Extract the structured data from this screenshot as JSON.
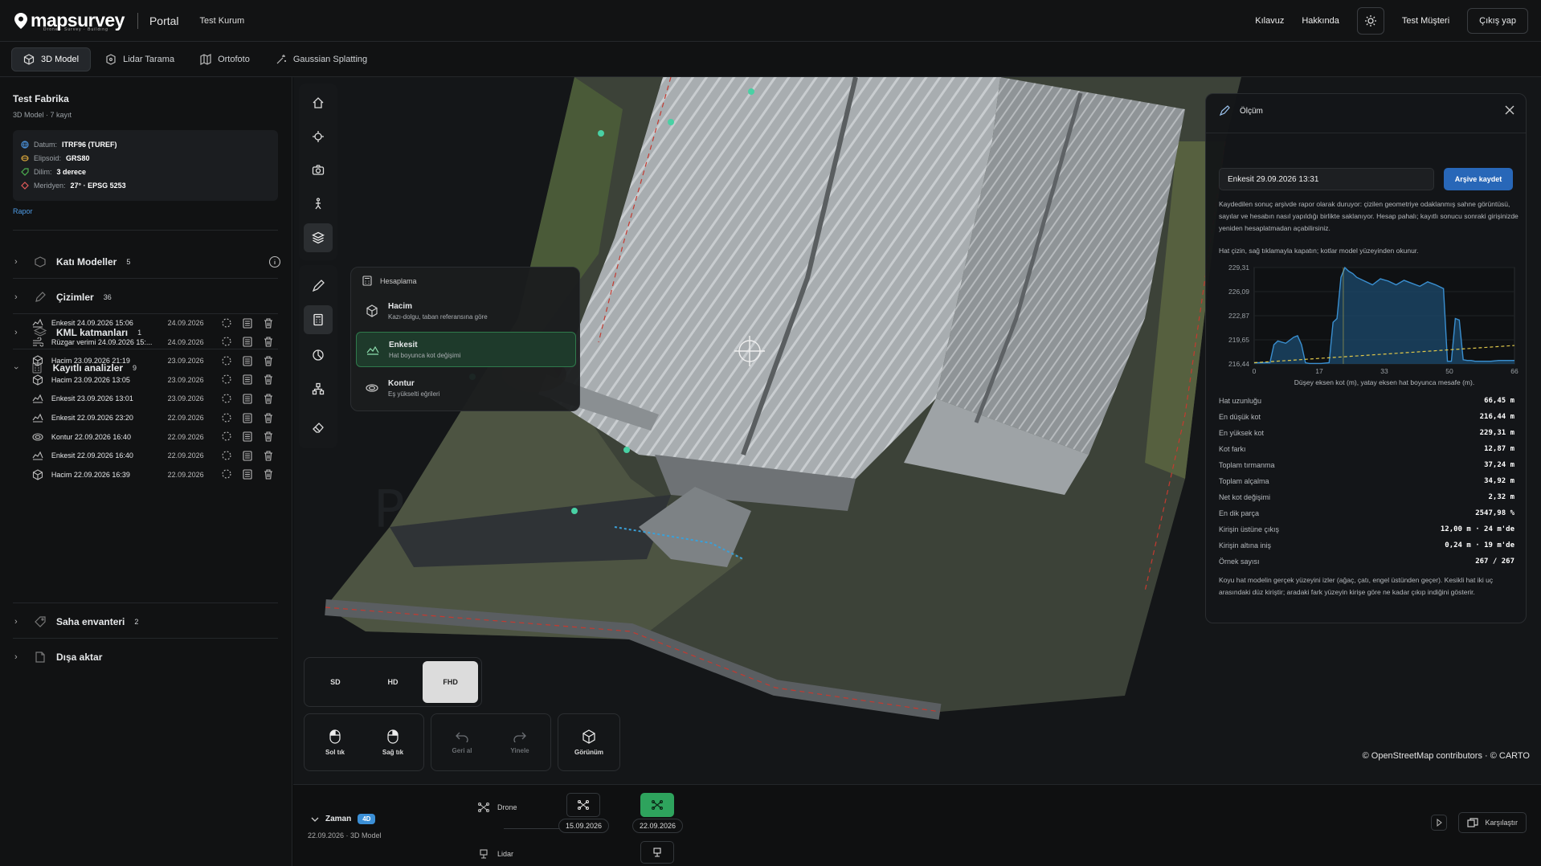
{
  "app": {
    "logo": "mapsurvey",
    "logo_sub": "Drone · Survey · Building",
    "portal": "Portal",
    "org": "Test Kurum",
    "links": [
      "Kılavuz",
      "Hakkında"
    ],
    "user": "Test Müşteri",
    "logout": "Çıkış yap"
  },
  "tabs": [
    {
      "label": "3D Model",
      "icon": "cube-icon"
    },
    {
      "label": "Lidar Tarama",
      "icon": "lidar-icon"
    },
    {
      "label": "Ortofoto",
      "icon": "map-icon"
    },
    {
      "label": "Gaussian Splatting",
      "icon": "sparkle-icon"
    }
  ],
  "project": {
    "title": "Test Fabrika",
    "subtitle": "3D Model · 7 kayıt",
    "info": [
      {
        "key": "Datum:",
        "value": "ITRF96 (TUREF)",
        "color": "#4a90d9"
      },
      {
        "key": "Elipsoid:",
        "value": "GRS80",
        "color": "#d4a23a"
      },
      {
        "key": "Dilim:",
        "value": "3 derece",
        "color": "#4caf50"
      },
      {
        "key": "Meridyen:",
        "value": "27° · EPSG 5253",
        "color": "#e05a5a"
      }
    ],
    "report_link": "Rapor"
  },
  "sections": [
    {
      "label": "Katı Modeller",
      "count": "5",
      "expanded": false
    },
    {
      "label": "Çizimler",
      "count": "36",
      "expanded": false
    },
    {
      "label": "KML katmanları",
      "count": "1",
      "expanded": false
    },
    {
      "label": "Kayıtlı analizler",
      "count": "9",
      "expanded": true
    },
    {
      "label": "Saha envanteri",
      "count": "2",
      "expanded": false
    },
    {
      "label": "Dışa aktar",
      "count": "",
      "expanded": false
    }
  ],
  "analyses": [
    {
      "name": "Enkesit 24.09.2026 15:06",
      "date": "24.09.2026",
      "icon": "profile-icon"
    },
    {
      "name": "Rüzgar verimi 24.09.2026 15:...",
      "date": "24.09.2026",
      "icon": "wind-icon"
    },
    {
      "name": "Hacim 23.09.2026 21:19",
      "date": "23.09.2026",
      "icon": "volume-icon"
    },
    {
      "name": "Hacim 23.09.2026 13:05",
      "date": "23.09.2026",
      "icon": "volume-icon"
    },
    {
      "name": "Enkesit 23.09.2026 13:01",
      "date": "23.09.2026",
      "icon": "profile-icon"
    },
    {
      "name": "Enkesit 22.09.2026 23:20",
      "date": "22.09.2026",
      "icon": "profile-icon"
    },
    {
      "name": "Kontur 22.09.2026 16:40",
      "date": "22.09.2026",
      "icon": "contour-icon"
    },
    {
      "name": "Enkesit 22.09.2026 16:40",
      "date": "22.09.2026",
      "icon": "profile-icon"
    },
    {
      "name": "Hacim 22.09.2026 16:39",
      "date": "22.09.2026",
      "icon": "volume-icon"
    }
  ],
  "calc_menu": {
    "header": "Hesaplama",
    "options": [
      {
        "title": "Hacim",
        "desc": "Kazı-dolgu, taban referansına göre",
        "selected": false
      },
      {
        "title": "Enkesit",
        "desc": "Hat boyunca kot değişimi",
        "selected": true
      },
      {
        "title": "Kontur",
        "desc": "Eş yükselti eğrileri",
        "selected": false
      }
    ]
  },
  "quality": {
    "options": [
      "SD",
      "HD",
      "FHD"
    ],
    "selected": "FHD"
  },
  "mouse": [
    {
      "label": "Sol tık",
      "enabled": true
    },
    {
      "label": "Sağ tık",
      "enabled": true
    },
    {
      "label": "Geri al",
      "enabled": false
    },
    {
      "label": "Yinele",
      "enabled": false
    },
    {
      "label": "Görünüm",
      "enabled": true
    }
  ],
  "attribution": "© OpenStreetMap contributors · © CARTO",
  "measure": {
    "title": "Ölçüm",
    "name_value": "Enkesit 29.09.2026 13:31",
    "save": "Arşive kaydet",
    "intro": "Kaydedilen sonuç arşivde rapor olarak duruyor: çizilen geometriye odaklanmış sahne görüntüsü, sayılar ve hesabın nasıl yapıldığı birlikte saklanıyor. Hesap pahalı; kayıtlı sonucu sonraki girişinizde yeniden hesaplatmadan açabilirsiniz.",
    "hint": "Hat çizin, sağ tıklamayla kapatın; kotlar model yüzeyinden okunur.",
    "chart_caption": "Düşey eksen kot (m), yatay eksen hat boyunca mesafe (m).",
    "stats": [
      {
        "k": "Hat uzunluğu",
        "v": "66,45 m"
      },
      {
        "k": "En düşük kot",
        "v": "216,44 m"
      },
      {
        "k": "En yüksek kot",
        "v": "229,31 m"
      },
      {
        "k": "Kot farkı",
        "v": "12,87 m"
      },
      {
        "k": "Toplam tırmanma",
        "v": "37,24 m"
      },
      {
        "k": "Toplam alçalma",
        "v": "34,92 m"
      },
      {
        "k": "Net kot değişimi",
        "v": "2,32 m"
      },
      {
        "k": "En dik parça",
        "v": "2547,98 %"
      },
      {
        "k": "Kirişin üstüne çıkış",
        "v": "12,00 m · 24 m'de"
      },
      {
        "k": "Kirişin altına iniş",
        "v": "0,24 m · 19 m'de"
      },
      {
        "k": "Örnek sayısı",
        "v": "267 / 267"
      }
    ],
    "footer": "Koyu hat modelin gerçek yüzeyini izler (ağaç, çatı, engel üstünden geçer). Kesikli hat iki uç arasındaki düz kiriştir; aradaki fark yüzeyin kirişe göre ne kadar çıkıp indiğini gösterir."
  },
  "chart_data": {
    "type": "area",
    "title": "",
    "xlabel": "",
    "ylabel": "",
    "xlim": [
      0,
      66
    ],
    "ylim": [
      216.44,
      229.31
    ],
    "x_ticks": [
      "0",
      "17",
      "33",
      "50",
      "66"
    ],
    "y_ticks": [
      "229,31",
      "226,09",
      "222,87",
      "219,65",
      "216,44"
    ],
    "series": [
      {
        "x": [
          0,
          4,
          5,
          6,
          8,
          10,
          11,
          12,
          13,
          14,
          17,
          19,
          20,
          21,
          22,
          23,
          24,
          25,
          26,
          28,
          30,
          32,
          34,
          36,
          38,
          40,
          42,
          44,
          46,
          48,
          49,
          50,
          51,
          52,
          53,
          54,
          55,
          56,
          58,
          60,
          62,
          64,
          66
        ],
        "y": [
          216.6,
          216.6,
          219.0,
          219.5,
          219.2,
          220.0,
          220.2,
          219.0,
          216.6,
          216.5,
          216.5,
          216.6,
          222.0,
          222.5,
          228.0,
          229.3,
          228.8,
          228.5,
          228.0,
          227.5,
          227.0,
          227.8,
          227.5,
          227.0,
          227.6,
          227.2,
          226.8,
          227.4,
          227.0,
          226.5,
          216.8,
          216.8,
          222.5,
          222.3,
          217.0,
          216.9,
          216.9,
          216.8,
          216.8,
          216.8,
          216.9,
          216.9,
          216.9
        ]
      },
      {
        "x": [
          0,
          66
        ],
        "y": [
          216.6,
          218.9
        ]
      }
    ]
  },
  "timeline": {
    "label": "Zaman",
    "badge": "4D",
    "sub": "22.09.2026 · 3D Model",
    "lanes": [
      "Drone",
      "Lidar"
    ],
    "dates": [
      "15.09.2026",
      "22.09.2026"
    ],
    "compare": "Karşılaştır"
  }
}
